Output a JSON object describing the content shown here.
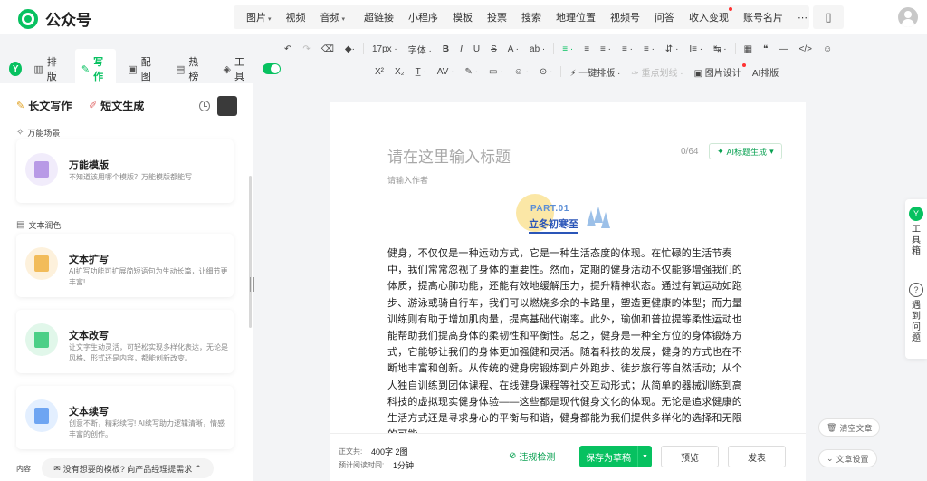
{
  "app": {
    "logo_text": "公众号"
  },
  "colors": {
    "accent": "#07c160",
    "banner_blue": "#2a55b8"
  },
  "insert_menu": [
    {
      "label": "图片",
      "caret": true
    },
    {
      "label": "视频",
      "caret": false
    },
    {
      "label": "音频",
      "caret": true
    }
  ],
  "insert_menu2": [
    {
      "label": "超链接",
      "dot": false
    },
    {
      "label": "小程序",
      "dot": false
    },
    {
      "label": "模板",
      "dot": false
    },
    {
      "label": "投票",
      "dot": false
    },
    {
      "label": "搜索",
      "dot": false
    },
    {
      "label": "地理位置",
      "dot": false
    },
    {
      "label": "视频号",
      "dot": false
    },
    {
      "label": "问答",
      "dot": false
    },
    {
      "label": "收入变现",
      "dot": true
    },
    {
      "label": "账号名片",
      "dot": false
    },
    {
      "label": "⋯",
      "dot": false
    }
  ],
  "left_tabs": [
    {
      "label": "排版",
      "icon": "layout-icon",
      "glyph": "▥",
      "active": false
    },
    {
      "label": "写作",
      "icon": "ai-write-icon",
      "glyph": "✎",
      "active": true
    },
    {
      "label": "配图",
      "icon": "image-icon",
      "glyph": "▣",
      "active": false
    },
    {
      "label": "热榜",
      "icon": "trend-icon",
      "glyph": "▤",
      "active": false
    },
    {
      "label": "工具",
      "icon": "cube-icon",
      "glyph": "◈",
      "active": false
    }
  ],
  "fmt_row1": [
    "↶",
    "↷",
    "⌫",
    "◆·",
    "17px ·",
    "字体 ·",
    "B",
    "I",
    "U",
    "S",
    "A ·",
    "ab ·",
    "≡ ·",
    "≡",
    "≡ ·",
    "≡ ·",
    "≡ ·",
    "⇵ ·",
    "I≡ ·",
    "↹ ·",
    "▦",
    "❝",
    "—",
    "</>",
    "☺"
  ],
  "fmt_row2": [
    "X²",
    "X₂",
    "T̲ ·",
    "AV ·",
    "✎ ·",
    "▭ ·",
    "☺ ·",
    "⊙ ·",
    "⚡ 一键排版 ·",
    "✑ 重点划线 ·",
    "▣ 图片设计",
    "AI排版"
  ],
  "sidebar": {
    "mode_long": "长文写作",
    "mode_short": "短文生成",
    "section1": "万能场景",
    "section2": "文本润色",
    "cards": [
      {
        "title": "万能模版",
        "desc": "不知道该用哪个模版？万能模版都能写"
      },
      {
        "title": "文本扩写",
        "desc": "AI扩写功能可扩展简短语句为生动长篇，让细节更丰富!"
      },
      {
        "title": "文本改写",
        "desc": "让文字生动灵活，可轻松实现多样化表达，无论是风格、形式还是内容，都能创新改变。"
      },
      {
        "title": "文本续写",
        "desc": "创意不断，精彩续写! AI续写助力逻辑清晰，情感丰富的创作。"
      }
    ],
    "foot_left": "内容",
    "foot_button": "没有想要的模板? 向产品经理提需求"
  },
  "editor": {
    "title_placeholder": "请在这里输入标题",
    "title_count": "0/64",
    "ai_title_button": "AI标题生成",
    "author_placeholder": "请输入作者",
    "banner_part": "PART.01",
    "banner_title": "立冬初寒至",
    "body": "健身，不仅仅是一种运动方式，它是一种生活态度的体现。在忙碌的生活节奏中，我们常常忽视了身体的重要性。然而，定期的健身活动不仅能够增强我们的体质，提高心肺功能，还能有效地缓解压力，提升精神状态。通过有氧运动如跑步、游泳或骑自行车，我们可以燃烧多余的卡路里，塑造更健康的体型；而力量训练则有助于增加肌肉量，提高基础代谢率。此外，瑜伽和普拉提等柔性运动也能帮助我们提高身体的柔韧性和平衡性。总之，健身是一种全方位的身体锻炼方式，它能够让我们的身体更加强健和灵活。随着科技的发展，健身的方式也在不断地丰富和创新。从传统的健身房锻炼到户外跑步、徒步旅行等自然活动；从个人独自训练到团体课程、在线健身课程等社交互动形式；从简单的器械训练到高科技的虚拟现实健身体验——这些都是现代健身文化的体现。无论是追求健康的生活方式还是寻求身心的平衡与和谐，健身都能为我们提供多样化的选择和无限的可能。"
  },
  "footer": {
    "body_label": "正文共:",
    "body_value": "400字 2图",
    "read_label": "预计阅读时间:",
    "read_value": "1分钟",
    "check_label": "违规检测",
    "save_draft": "保存为草稿",
    "preview": "预览",
    "publish": "发表"
  },
  "right_panel": {
    "toolbox": "工具箱",
    "help": "遇到问题",
    "clear": "清空文章",
    "settings": "文章设置"
  }
}
